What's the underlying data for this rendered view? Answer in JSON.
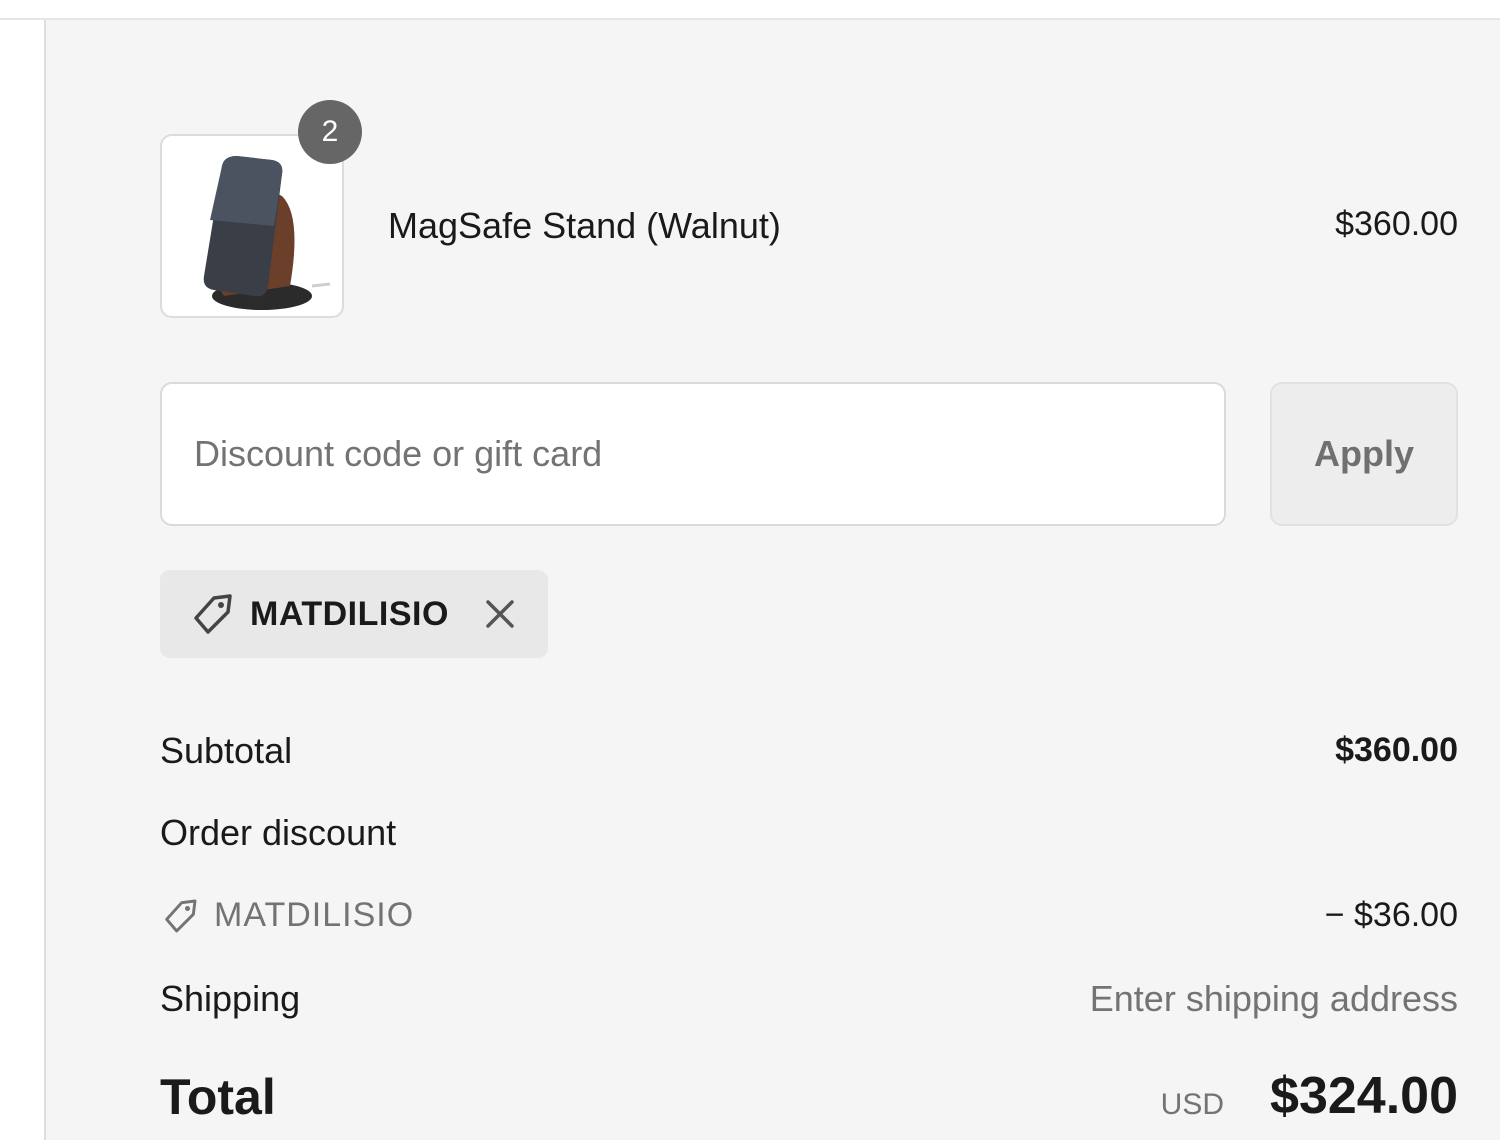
{
  "cart": {
    "item": {
      "quantity": "2",
      "name": "MagSafe Stand (Walnut)",
      "price": "$360.00",
      "image_icon": "magsafe-stand-product-image"
    }
  },
  "discount": {
    "placeholder": "Discount code or gift card",
    "value": "",
    "apply_label": "Apply",
    "applied_code": "MATDILISIO"
  },
  "summary": {
    "subtotal_label": "Subtotal",
    "subtotal_value": "$360.00",
    "order_discount_label": "Order discount",
    "discount_code": "MATDILISIO",
    "discount_amount": "− $36.00",
    "shipping_label": "Shipping",
    "shipping_value": "Enter shipping address",
    "total_label": "Total",
    "currency": "USD",
    "total_value": "$324.00"
  },
  "colors": {
    "panel_background": "#f5f5f5",
    "muted_text": "#737373",
    "badge": "#666666",
    "chip_background": "#e8e8e8"
  }
}
